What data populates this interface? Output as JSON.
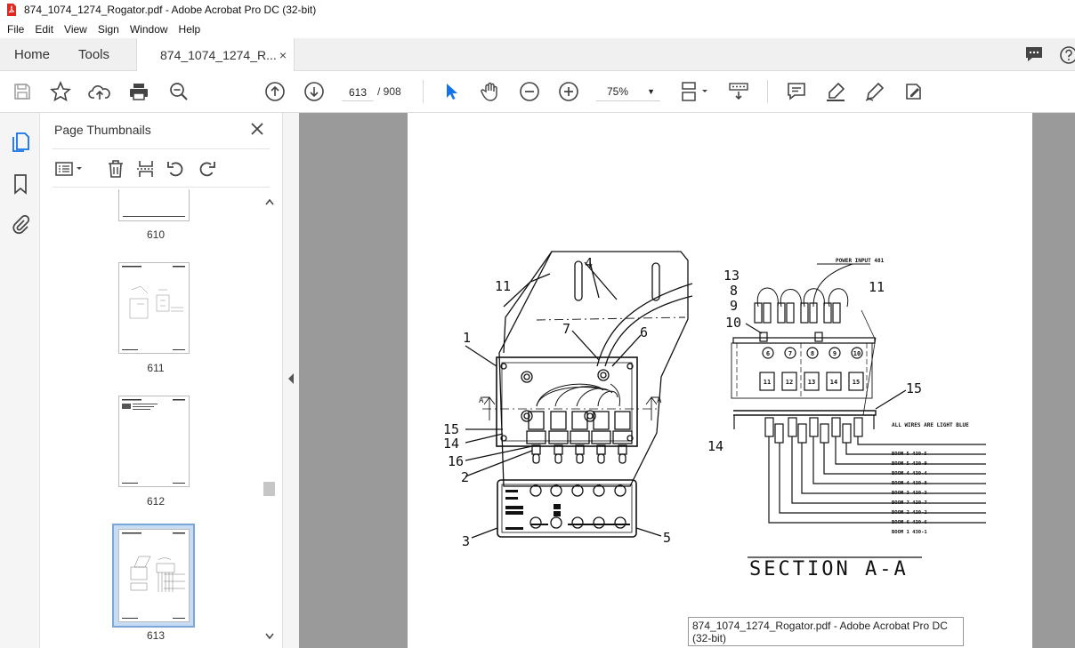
{
  "window": {
    "title": "874_1074_1274_Rogator.pdf - Adobe Acrobat Pro DC (32-bit)"
  },
  "menu": [
    "File",
    "Edit",
    "View",
    "Sign",
    "Window",
    "Help"
  ],
  "tabs": {
    "home": "Home",
    "tools": "Tools",
    "document": "874_1074_1274_R...",
    "close_glyph": "×"
  },
  "toolbar": {
    "page_current": "613",
    "page_total": "/  908",
    "zoom": "75%",
    "zoom_caret": "▼"
  },
  "panel": {
    "title": "Page Thumbnails",
    "thumbnails": [
      {
        "label": "610"
      },
      {
        "label": "611"
      },
      {
        "label": "612"
      },
      {
        "label": "613"
      }
    ],
    "selected_thumbnail": "613"
  },
  "drawing": {
    "labels": {
      "l11a": "11",
      "l4": "4",
      "l1": "1",
      "l7": "7",
      "l6": "6",
      "l15a": "15",
      "l14a": "14",
      "l16": "16",
      "l2": "2",
      "l3": "3",
      "l5": "5",
      "l13": "13",
      "l8": "8",
      "l9": "9",
      "l10": "10",
      "l11b": "11",
      "l15b": "15",
      "l14b": "14",
      "a_left": "A",
      "a_right": "A"
    },
    "power_input": "POWER INPUT 481",
    "wire_note": "ALL WIRES ARE LIGHT BLUE",
    "circle_numbers": [
      "6",
      "7",
      "8",
      "9",
      "10"
    ],
    "square_numbers": [
      "11",
      "12",
      "13",
      "14",
      "15"
    ],
    "boom_labels": [
      "BOOM 5  430-5",
      "BOOM 5  430-9",
      "BOOM 4  430-4",
      "BOOM 4  430-8",
      "BOOM 3  430-3",
      "BOOM 7  430-7",
      "BOOM 2  430-2",
      "BOOM 6  430-6",
      "BOOM 1  430-1"
    ],
    "section_title": "SECTION  A-A"
  },
  "tooltip": "874_1074_1274_Rogator.pdf - Adobe Acrobat Pro DC (32-bit)",
  "colors": {
    "accent": "#1473e6",
    "pdf_red": "#e0281e",
    "doc_bg": "#9a9a9a"
  }
}
